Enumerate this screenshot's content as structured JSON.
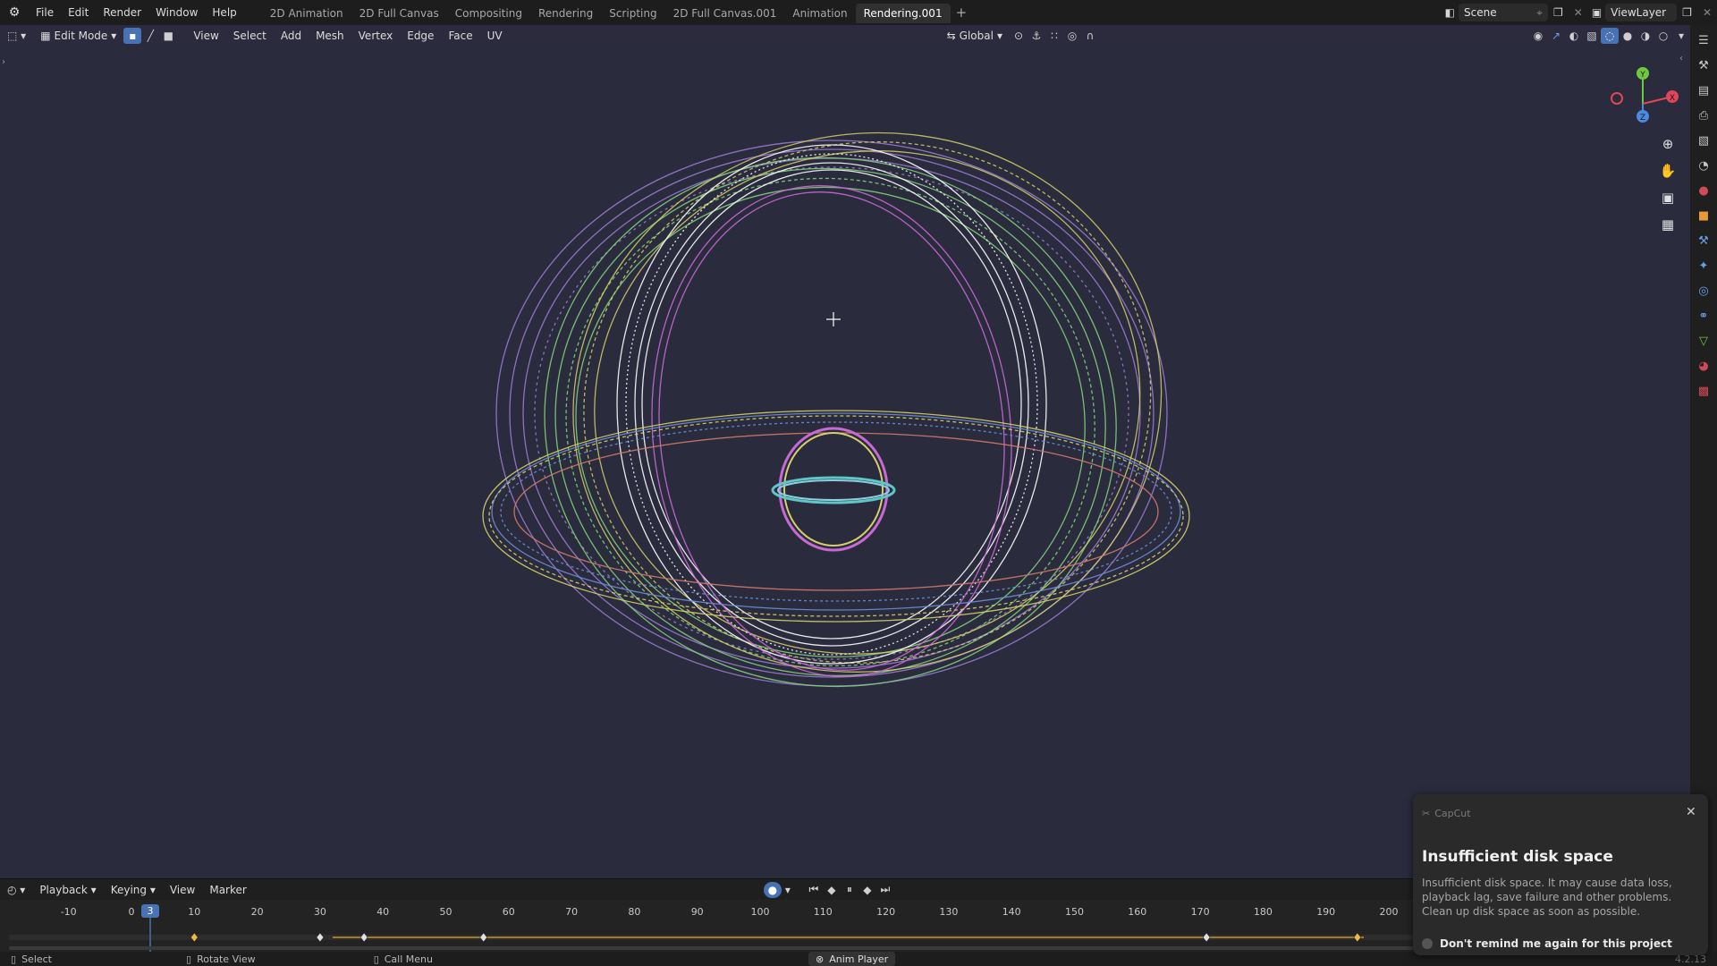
{
  "menu": [
    "File",
    "Edit",
    "Render",
    "Window",
    "Help"
  ],
  "workspaces": [
    "2D Animation",
    "2D Full Canvas",
    "Compositing",
    "Rendering",
    "Scripting",
    "2D Full Canvas.001",
    "Animation",
    "Rendering.001"
  ],
  "active_workspace": "Rendering.001",
  "scene_name": "Scene",
  "view_layer": "ViewLayer",
  "header": {
    "mode": "Edit Mode",
    "menus": [
      "View",
      "Select",
      "Add",
      "Mesh",
      "Vertex",
      "Edge",
      "Face",
      "UV"
    ],
    "orientation": "Global"
  },
  "gizmo": {
    "y": "Y",
    "x": "X",
    "z": "Z"
  },
  "timeline": {
    "menus": [
      "Playback",
      "Keying",
      "View",
      "Marker"
    ],
    "current_frame": "3",
    "ticks": [
      "-10",
      "0",
      "10",
      "20",
      "30",
      "40",
      "50",
      "60",
      "70",
      "80",
      "90",
      "100",
      "110",
      "120",
      "130",
      "140",
      "150",
      "160",
      "170",
      "180",
      "190",
      "200"
    ]
  },
  "status": {
    "select": "Select",
    "rotate": "Rotate View",
    "call_menu": "Call Menu",
    "anim_player": "Anim Player",
    "version": "4.2.13"
  },
  "notification": {
    "app": "CapCut",
    "title": "Insufficient disk space",
    "body": "Insufficient disk space. It may cause data loss, playback lag, save failure and other problems. Clean up disk space as soon as possible.",
    "checkbox": "Don't remind me again for this project"
  },
  "colors": {
    "viewport_bg": "#2a2b3c",
    "accent": "#4772b3",
    "keyframe": "#e8b84a",
    "ring_purple": "#a07ed8",
    "ring_green": "#7fd07a",
    "ring_yellow": "#d6d06a",
    "ring_white": "#f2f2f2",
    "ring_magenta": "#c86ad6",
    "ring_blue": "#6a8ed6"
  }
}
